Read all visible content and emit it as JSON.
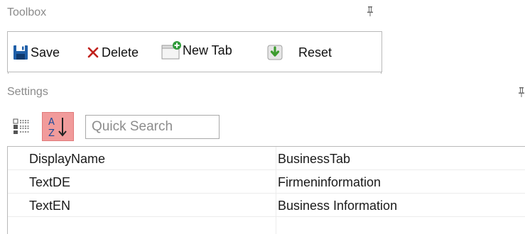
{
  "toolbox": {
    "title": "Toolbox",
    "buttons": {
      "save": "Save",
      "delete": "Delete",
      "new_tab": "New Tab",
      "reset": "Reset"
    }
  },
  "settings": {
    "title": "Settings",
    "search": {
      "placeholder": "Quick Search",
      "value": ""
    },
    "rows": [
      {
        "name": "DisplayName",
        "value": "BusinessTab"
      },
      {
        "name": "TextDE",
        "value": "Firmeninformation"
      },
      {
        "name": "TextEN",
        "value": "Business Information"
      }
    ]
  },
  "icons": {
    "save": "save-disk-icon",
    "delete": "delete-x-icon",
    "new_tab": "new-tab-icon",
    "reset": "reset-arrow-icon",
    "categorized": "categorized-view-icon",
    "sort": "sort-az-icon",
    "pin": "pin-icon"
  },
  "colors": {
    "save_icon": "#1f5fa8",
    "delete_icon": "#c0201b",
    "reset_icon": "#3c9b2e",
    "sort_active_bg": "#f19b9b",
    "panel_title": "#8a8a8a"
  }
}
